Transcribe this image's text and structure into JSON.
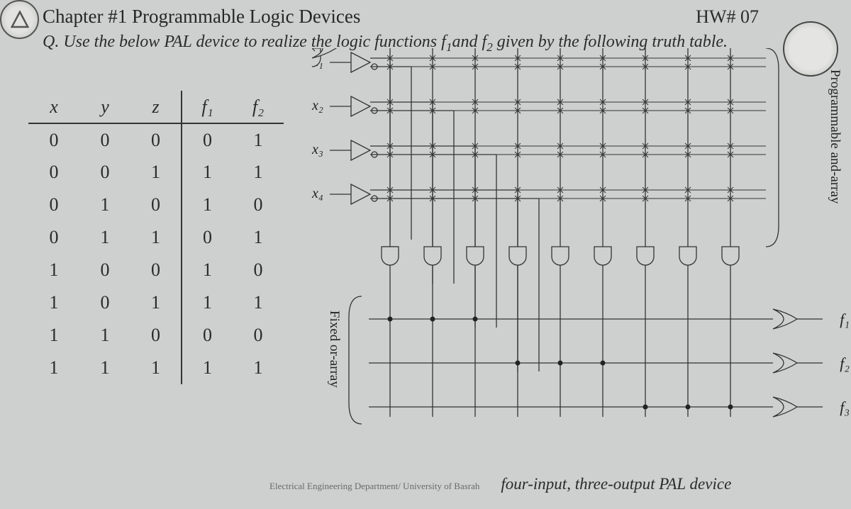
{
  "header": {
    "chapter_title": "Chapter #1 Programmable Logic Devices",
    "hw_label": "HW# 07"
  },
  "question": {
    "prefix": "Q. ",
    "text_before": "Use the below PAL device to realize the  logic functions f",
    "sub1": "1",
    "text_mid": "and f",
    "sub2": "2",
    "text_after": " given by the following truth table."
  },
  "truth_table": {
    "headers": [
      "x",
      "y",
      "z",
      "f₁",
      "f₂"
    ],
    "rows": [
      [
        "0",
        "0",
        "0",
        "0",
        "1"
      ],
      [
        "0",
        "0",
        "1",
        "1",
        "1"
      ],
      [
        "0",
        "1",
        "0",
        "1",
        "0"
      ],
      [
        "0",
        "1",
        "1",
        "0",
        "1"
      ],
      [
        "1",
        "0",
        "0",
        "1",
        "0"
      ],
      [
        "1",
        "0",
        "1",
        "1",
        "1"
      ],
      [
        "1",
        "1",
        "0",
        "0",
        "0"
      ],
      [
        "1",
        "1",
        "1",
        "1",
        "1"
      ]
    ]
  },
  "pal": {
    "inputs": {
      "x1": "x₁",
      "x2": "x₂",
      "x3": "x₃",
      "x4": "x₄"
    },
    "outputs": {
      "f1": "f₁",
      "f2": "f₂",
      "f3": "f₃"
    },
    "fixed_or_label": "Fixed or-array",
    "prog_and_label": "Programmable and-array",
    "caption": "four-input, three-output PAL device",
    "dept": "Electrical Engineering Department/ University of Basrah"
  }
}
